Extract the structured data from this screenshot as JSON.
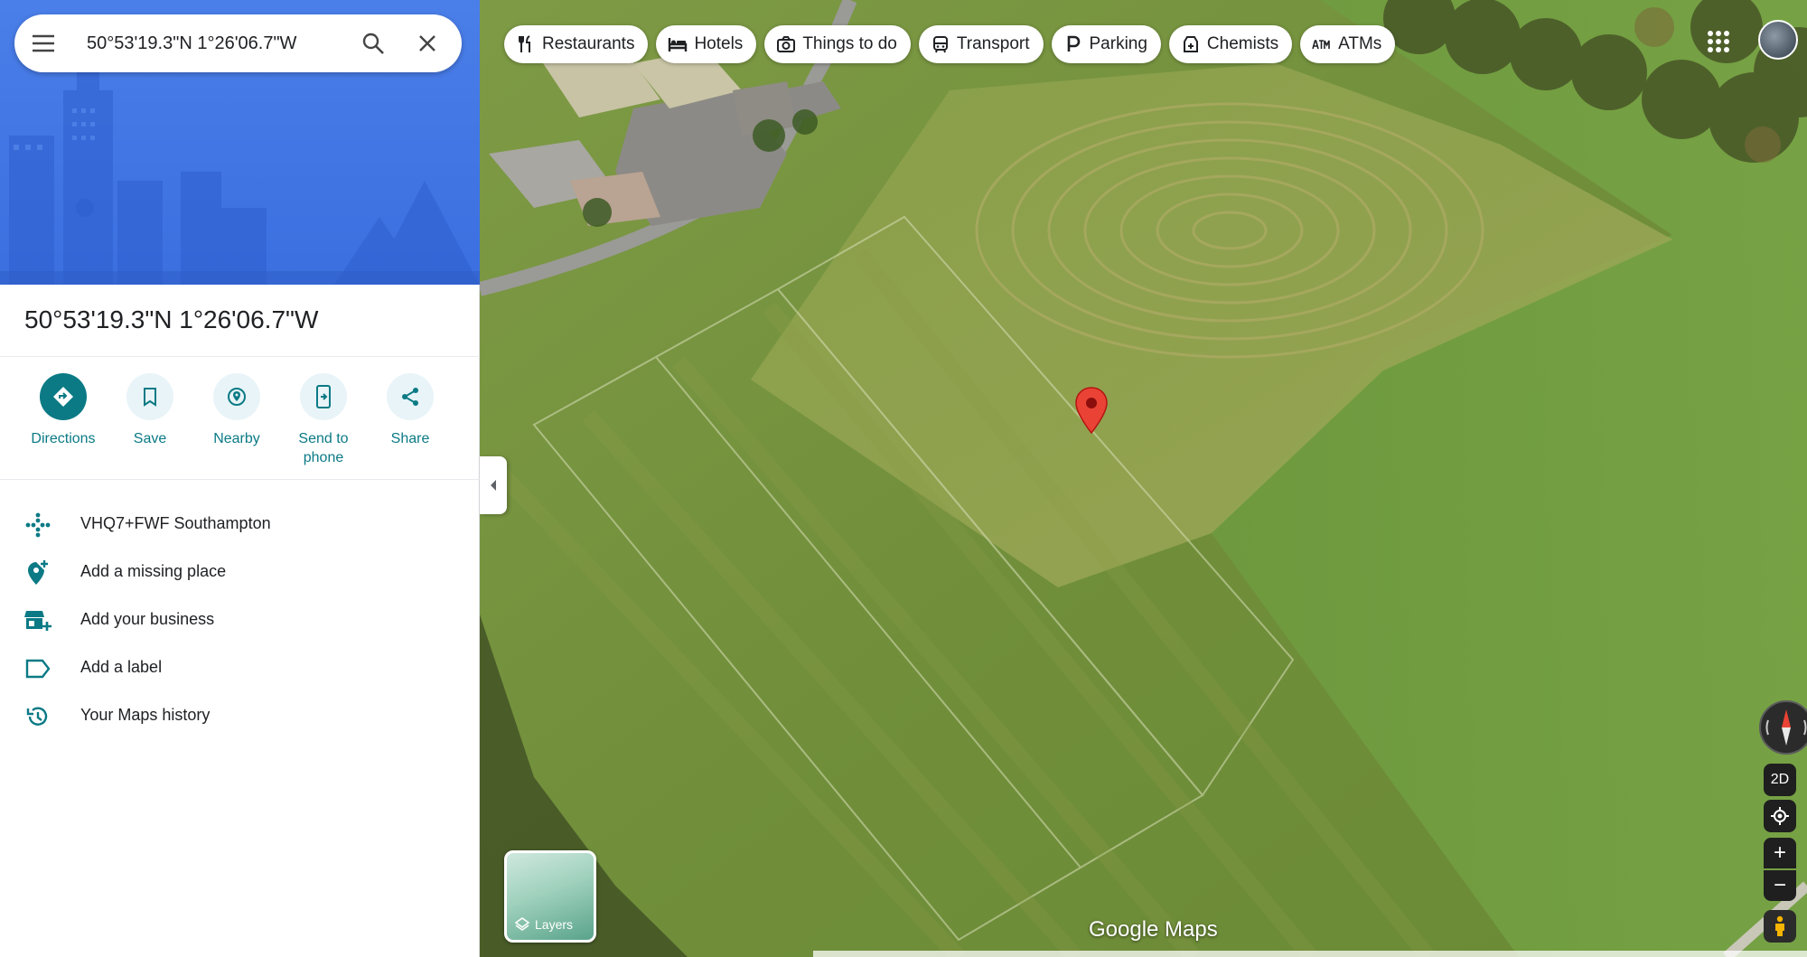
{
  "search": {
    "query": "50°53'19.3\"N 1°26'06.7\"W",
    "menu_icon": "hamburger-menu-icon",
    "search_icon": "search-icon",
    "close_icon": "close-icon"
  },
  "place": {
    "title": "50°53'19.3\"N 1°26'06.7\"W"
  },
  "actions": [
    {
      "label": "Directions",
      "icon": "directions-icon"
    },
    {
      "label": "Save",
      "icon": "bookmark-icon"
    },
    {
      "label": "Nearby",
      "icon": "nearby-icon"
    },
    {
      "label": "Send to phone",
      "icon": "send-to-phone-icon"
    },
    {
      "label": "Share",
      "icon": "share-icon"
    }
  ],
  "info_rows": [
    {
      "text": "VHQ7+FWF Southampton",
      "icon": "plus-code-icon"
    },
    {
      "text": "Add a missing place",
      "icon": "add-location-icon"
    },
    {
      "text": "Add your business",
      "icon": "add-business-icon"
    },
    {
      "text": "Add a label",
      "icon": "label-icon"
    },
    {
      "text": "Your Maps history",
      "icon": "history-icon"
    }
  ],
  "chips": [
    {
      "label": "Restaurants",
      "icon": "restaurant-icon"
    },
    {
      "label": "Hotels",
      "icon": "hotel-icon"
    },
    {
      "label": "Things to do",
      "icon": "camera-icon"
    },
    {
      "label": "Transport",
      "icon": "transport-icon"
    },
    {
      "label": "Parking",
      "icon": "parking-icon"
    },
    {
      "label": "Chemists",
      "icon": "chemist-icon"
    },
    {
      "label": "ATMs",
      "icon": "atm-icon"
    }
  ],
  "map_controls": {
    "view_toggle": "2D",
    "zoom_in": "+",
    "zoom_out": "−"
  },
  "layers": {
    "label": "Layers"
  },
  "branding": {
    "text": "Google Maps"
  },
  "colors": {
    "accent": "#0b7a85",
    "hero_blue": "#3b6fe0",
    "pin_red": "#ea4335"
  }
}
